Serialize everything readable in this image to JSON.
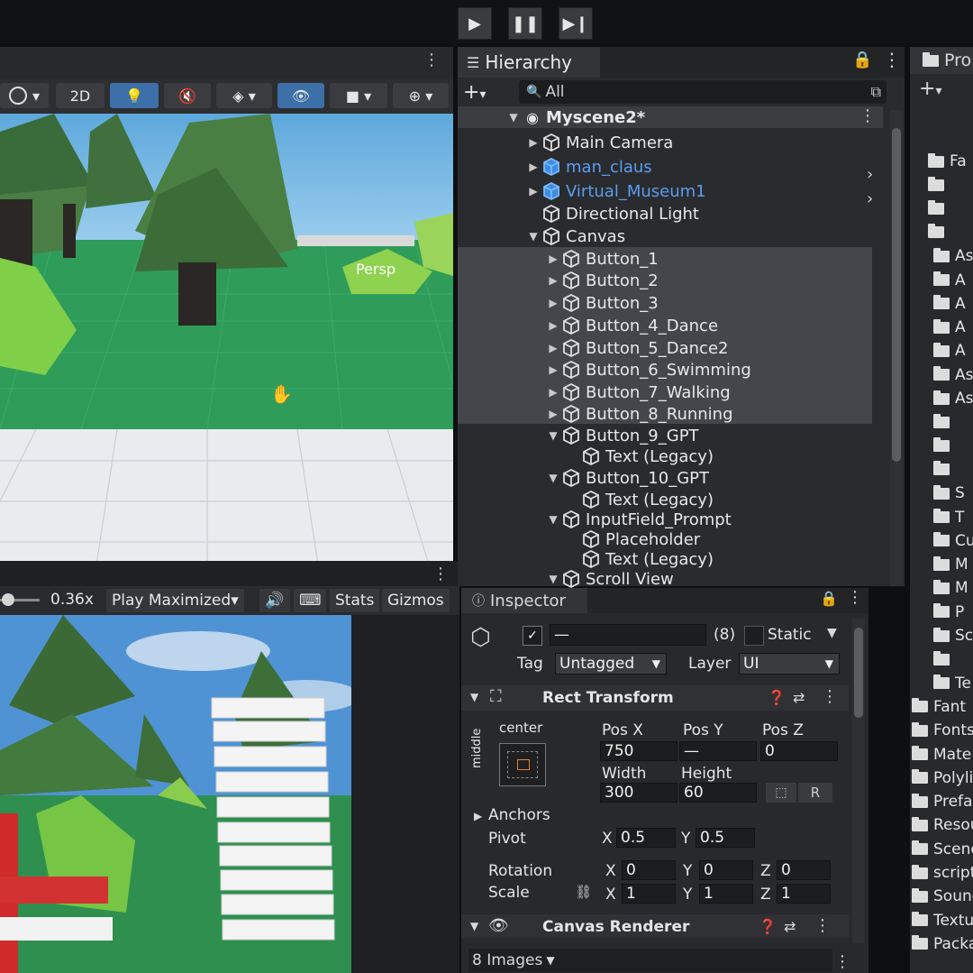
{
  "scene_view": {
    "toolbar": {
      "mode_2d": "2D",
      "persp_label": "Persp"
    }
  },
  "game_view": {
    "scale_value": "0.36x",
    "play_maximized": "Play Maximized",
    "stats": "Stats",
    "gizmos": "Gizmos"
  },
  "hierarchy": {
    "tab": "Hierarchy",
    "search_placeholder": "All",
    "scene_name": "Myscene2*",
    "items": [
      {
        "label": "Main Camera",
        "depth": 1,
        "arrow": "▶",
        "prefab": false
      },
      {
        "label": "man_claus",
        "depth": 1,
        "arrow": "▶",
        "prefab": true
      },
      {
        "label": "Virtual_Museum1",
        "depth": 1,
        "arrow": "▶",
        "prefab": true
      },
      {
        "label": "Directional Light",
        "depth": 1,
        "arrow": "",
        "prefab": false
      },
      {
        "label": "Canvas",
        "depth": 1,
        "arrow": "▼",
        "prefab": false
      },
      {
        "label": "Button_1",
        "depth": 2,
        "arrow": "▶",
        "prefab": false
      },
      {
        "label": "Button_2",
        "depth": 2,
        "arrow": "▶",
        "prefab": false
      },
      {
        "label": "Button_3",
        "depth": 2,
        "arrow": "▶",
        "prefab": false
      },
      {
        "label": "Button_4_Dance",
        "depth": 2,
        "arrow": "▶",
        "prefab": false
      },
      {
        "label": "Button_5_Dance2",
        "depth": 2,
        "arrow": "▶",
        "prefab": false
      },
      {
        "label": "Button_6_Swimming",
        "depth": 2,
        "arrow": "▶",
        "prefab": false
      },
      {
        "label": "Button_7_Walking",
        "depth": 2,
        "arrow": "▶",
        "prefab": false
      },
      {
        "label": "Button_8_Running",
        "depth": 2,
        "arrow": "▶",
        "prefab": false
      },
      {
        "label": "Button_9_GPT",
        "depth": 2,
        "arrow": "▼",
        "prefab": false
      },
      {
        "label": "Text (Legacy)",
        "depth": 3,
        "arrow": "",
        "prefab": false
      },
      {
        "label": "Button_10_GPT",
        "depth": 2,
        "arrow": "▼",
        "prefab": false
      },
      {
        "label": "Text (Legacy)",
        "depth": 3,
        "arrow": "",
        "prefab": false
      },
      {
        "label": "InputField_Prompt",
        "depth": 2,
        "arrow": "▼",
        "prefab": false
      },
      {
        "label": "Placeholder",
        "depth": 3,
        "arrow": "",
        "prefab": false
      },
      {
        "label": "Text (Legacy)",
        "depth": 3,
        "arrow": "",
        "prefab": false
      },
      {
        "label": "Scroll View",
        "depth": 2,
        "arrow": "▼",
        "prefab": false
      }
    ]
  },
  "inspector": {
    "tab": "Inspector",
    "name_value": "—",
    "count": "(8)",
    "static_label": "Static",
    "tag_label": "Tag",
    "tag_value": "Untagged",
    "layer_label": "Layer",
    "layer_value": "UI",
    "rect_transform": "Rect Transform",
    "anchor_h": "center",
    "anchor_v": "middle",
    "pos_x_label": "Pos X",
    "pos_y_label": "Pos Y",
    "pos_z_label": "Pos Z",
    "pos_x": "750",
    "pos_y": "—",
    "pos_z": "0",
    "width_label": "Width",
    "height_label": "Height",
    "width": "300",
    "height": "60",
    "r_button": "R",
    "anchors": "Anchors",
    "pivot_label": "Pivot",
    "pivot_x": "0.5",
    "pivot_y": "0.5",
    "rotation_label": "Rotation",
    "rot_x": "0",
    "rot_y": "0",
    "rot_z": "0",
    "scale_label": "Scale",
    "scale_x": "1",
    "scale_y": "1",
    "scale_z": "1",
    "x": "X",
    "y": "Y",
    "z": "Z",
    "canvas_renderer": "Canvas Renderer",
    "images_dropdown": "8 Images"
  },
  "project": {
    "tab": "Pro",
    "rows": [
      "Fa",
      "",
      "",
      "",
      "As",
      "A",
      "A",
      "A",
      "A",
      "As",
      "As",
      "",
      "",
      "",
      "S",
      "T",
      "Cul",
      "M",
      "M",
      "P",
      "Sc",
      "",
      "Te",
      "Fant",
      "Fonts",
      "Mate",
      "Polyli",
      "Prefal",
      "Resou",
      "Scene",
      "scripts",
      "Sound",
      "Textur",
      "Package"
    ]
  },
  "colors": {
    "accent": "#3d6fa8",
    "prefab_blue": "#5a9ef0",
    "selection": "#4a4d52"
  }
}
